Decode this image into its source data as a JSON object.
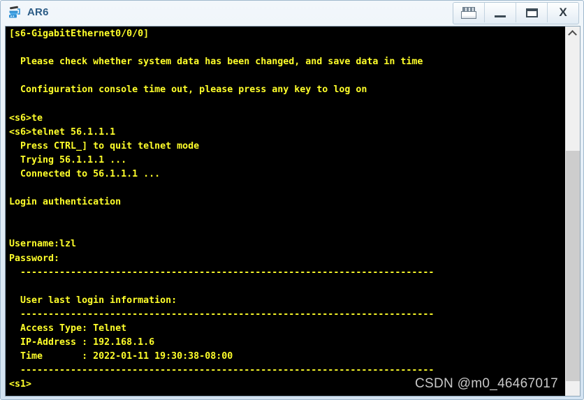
{
  "window": {
    "title": "AR6",
    "icon": "router-icon",
    "buttons": [
      {
        "name": "restore-button",
        "label": ""
      },
      {
        "name": "minimize-button",
        "label": ""
      },
      {
        "name": "maximize-button",
        "label": ""
      },
      {
        "name": "close-button",
        "label": "X"
      }
    ]
  },
  "terminal": {
    "background_color": "#000000",
    "text_color": "#ffff2a",
    "content": "[s6-GigabitEthernet0/0/0]\n\n  Please check whether system data has been changed, and save data in time\n\n  Configuration console time out, please press any key to log on\n\n<s6>te\n<s6>telnet 56.1.1.1\n  Press CTRL_] to quit telnet mode\n  Trying 56.1.1.1 ...\n  Connected to 56.1.1.1 ...\n\nLogin authentication\n\n\nUsername:lzl\nPassword:\n  --------------------------------------------------------------------------\n\n  User last login information:\n  --------------------------------------------------------------------------\n  Access Type: Telnet\n  IP-Address : 192.168.1.6\n  Time       : 2022-01-11 19:30:38-08:00\n  --------------------------------------------------------------------------\n<s1>"
  },
  "scrollbar": {
    "up_arrow": "chevron-up-icon",
    "thumb_position": "bottom"
  },
  "watermark": {
    "text": "CSDN @m0_46467017"
  }
}
